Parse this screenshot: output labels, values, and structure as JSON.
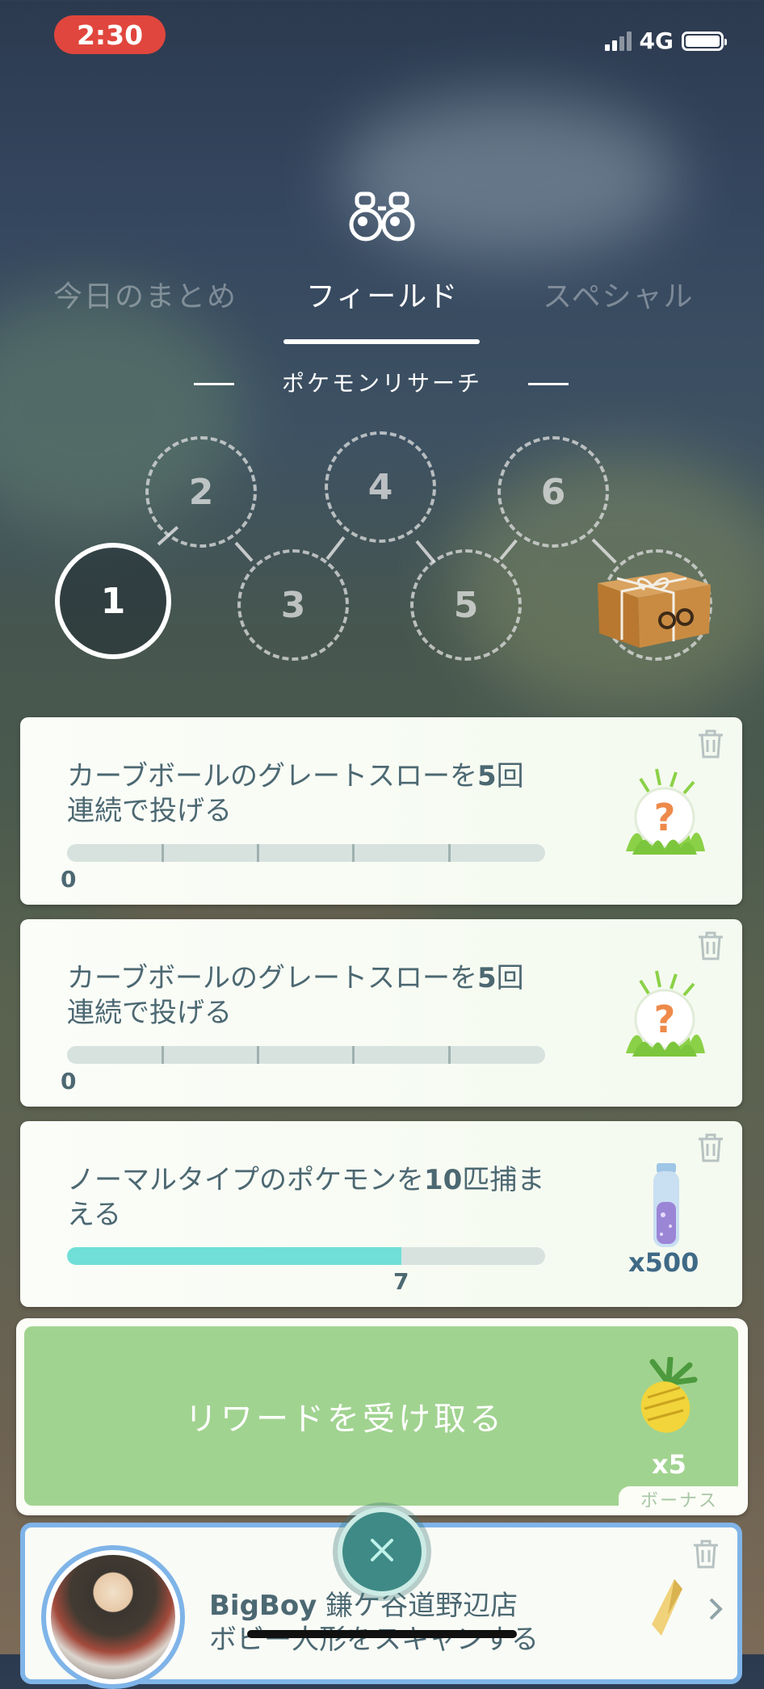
{
  "status_bar": {
    "time": "2:30",
    "network": "4G"
  },
  "header": {
    "tabs": [
      {
        "label": "今日のまとめ"
      },
      {
        "label": "フィールド"
      },
      {
        "label": "スペシャル"
      }
    ],
    "active_tab": "フィールド",
    "section_title": "ポケモンリサーチ"
  },
  "progress": {
    "steps": [
      "1",
      "2",
      "3",
      "4",
      "5",
      "6"
    ],
    "current_step": "1"
  },
  "tasks": [
    {
      "text_a": "カーブボールのグレートスローを",
      "text_num": "5",
      "text_b": "回",
      "text_line2": "連続で投げる",
      "progress_value": "0",
      "progress_fraction": 0,
      "reward": "mystery-encounter-icon"
    },
    {
      "text_a": "カーブボールのグレートスローを",
      "text_num": "5",
      "text_b": "回",
      "text_line2": "連続で投げる",
      "progress_value": "0",
      "progress_fraction": 0,
      "reward": "mystery-encounter-icon"
    },
    {
      "text_a": "ノーマルタイプのポケモンを",
      "text_num": "10",
      "text_b": "匹捕ま",
      "text_line2": "える",
      "progress_value": "7",
      "progress_fraction": 0.7,
      "reward": "stardust-icon",
      "reward_qty": "x500"
    }
  ],
  "claim": {
    "label": "リワードを受け取る",
    "reward_qty": "x5",
    "bonus_label": "ボーナス"
  },
  "special_task": {
    "title_bold": "BigBoy",
    "title_rest": " 鎌ケ谷道野辺店",
    "line2": "ボビー人形をスキャンする"
  },
  "colors": {
    "time_pill": "#e0463d",
    "progress_fill": "#6fdfd8",
    "claim_button": "#a1d390",
    "special_border": "#7fb4e8",
    "close_button": "#3f8a86"
  }
}
